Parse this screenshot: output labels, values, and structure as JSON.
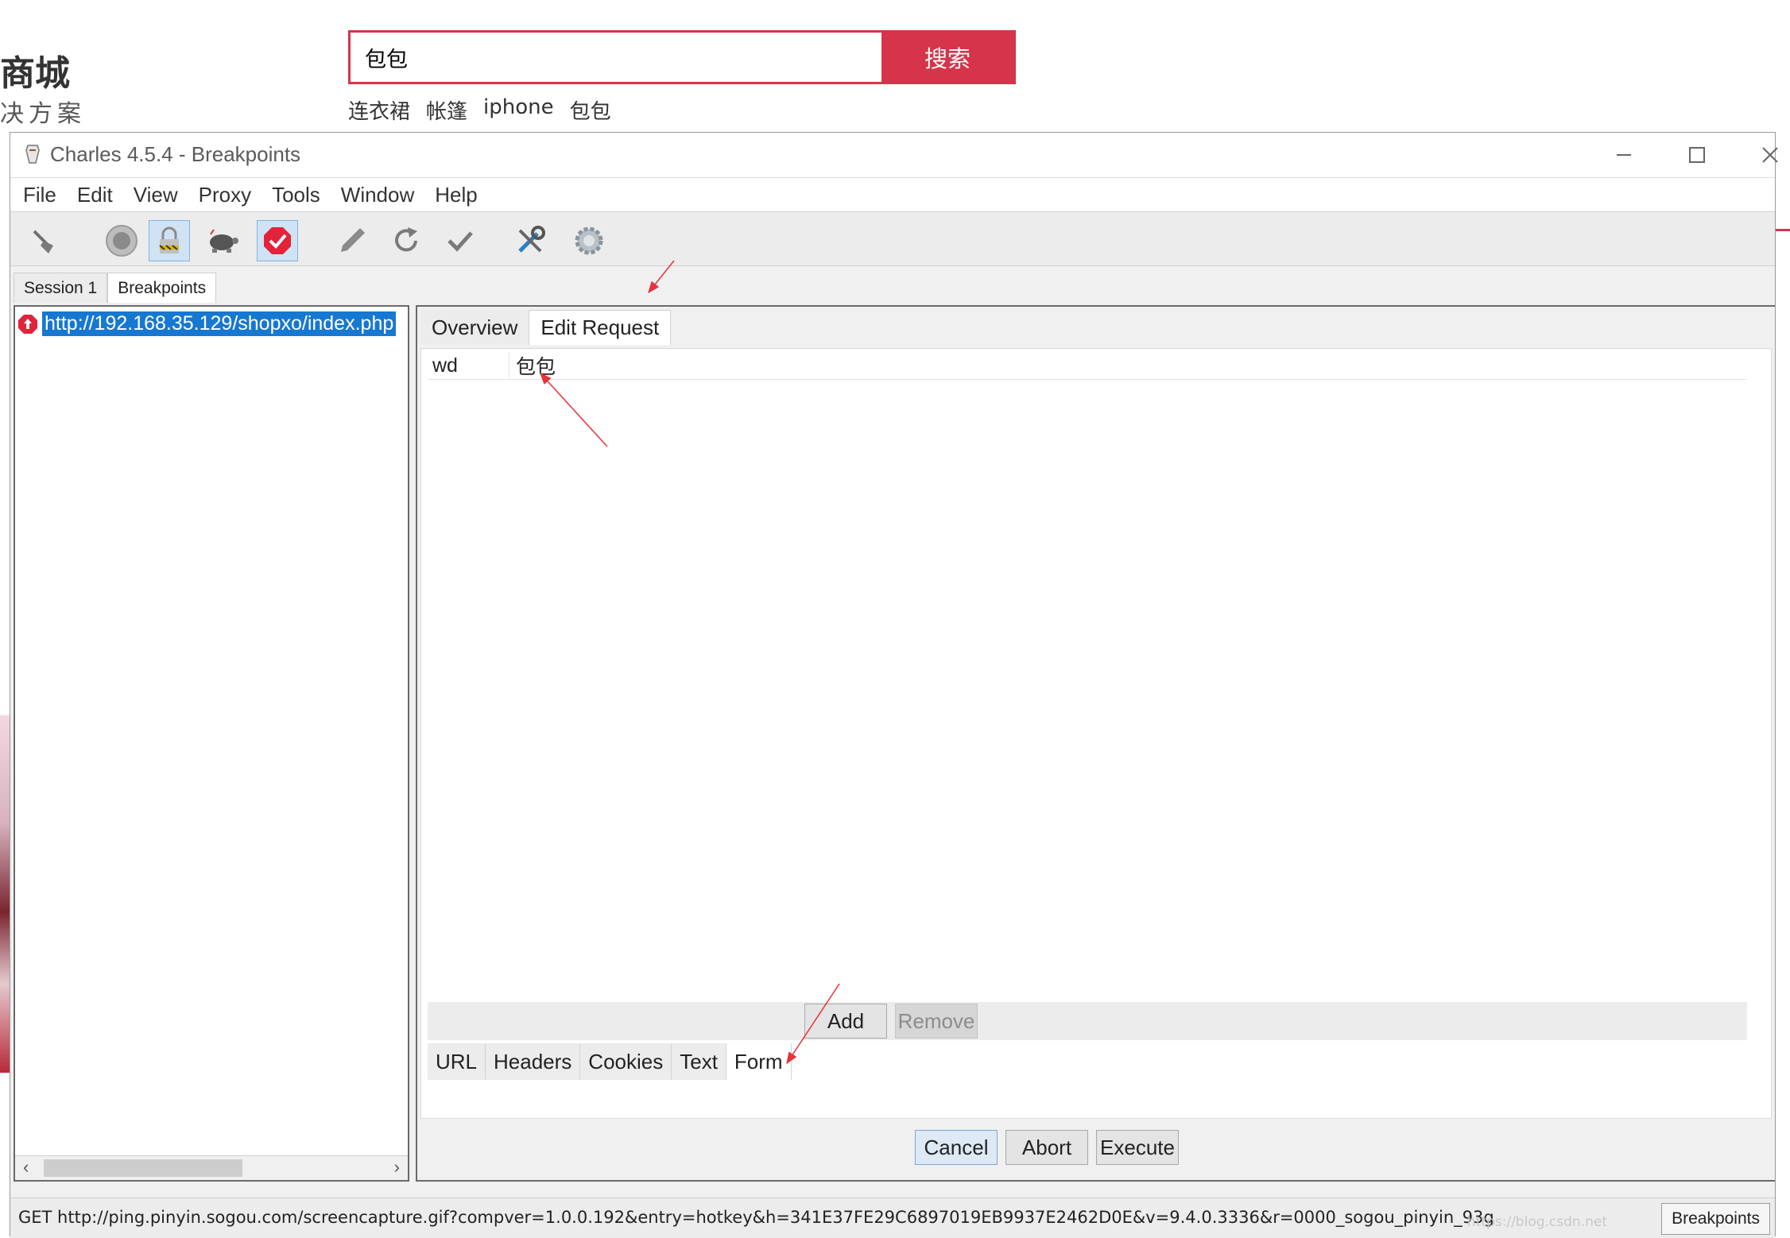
{
  "webpage": {
    "logo_main": "商城",
    "logo_sub": "决方案",
    "search_value": "包包",
    "search_button": "搜索",
    "hot_words": [
      "连衣裙",
      "帐篷",
      "iphone",
      "包包"
    ]
  },
  "window": {
    "title": "Charles 4.5.4 - Breakpoints",
    "menu": [
      "File",
      "Edit",
      "View",
      "Proxy",
      "Tools",
      "Window",
      "Help"
    ],
    "toolbar_icons": [
      "broom-icon",
      "record-icon",
      "ssl-proxy-icon",
      "throttle-turtle-icon",
      "breakpoints-icon",
      "pen-icon",
      "refresh-icon",
      "validate-check-icon",
      "tools-icon",
      "settings-gear-icon"
    ],
    "session_tabs": [
      "Session 1",
      "Breakpoints"
    ],
    "tree_item_url": "http://192.168.35.129/shopxo/index.php",
    "top_tabs": [
      "Overview",
      "Edit Request"
    ],
    "form_params": [
      {
        "name": "wd",
        "value": "包包"
      }
    ],
    "add_label": "Add",
    "remove_label": "Remove",
    "bottom_tabs": [
      "URL",
      "Headers",
      "Cookies",
      "Text",
      "Form"
    ],
    "cancel_label": "Cancel",
    "abort_label": "Abort",
    "execute_label": "Execute",
    "status_text": "GET http://ping.pinyin.sogou.com/screencapture.gif?compver=1.0.0.192&entry=hotkey&h=341E37FE29C6897019EB9937E2462D0E&v=9.4.0.3336&r=0000_sogou_pinyin_93g",
    "status_button": "Breakpoints"
  },
  "watermark": "https://blog.csdn.net",
  "colors": {
    "accent": "#d6344a",
    "selection": "#1778d2",
    "arrow": "#e8313a"
  }
}
